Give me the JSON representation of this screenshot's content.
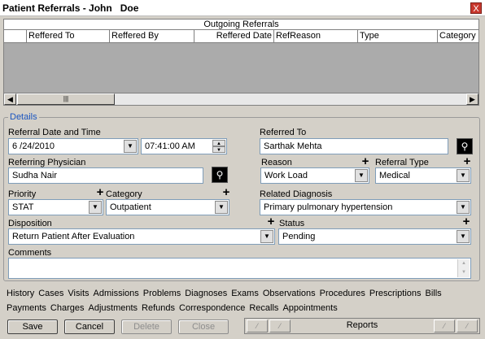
{
  "window": {
    "title": "Patient Referrals - John   Doe",
    "close_label": "X"
  },
  "grid": {
    "caption": "Outgoing Referrals",
    "columns": [
      "",
      "Reffered To",
      "Reffered By",
      "Reffered Date",
      "RefReason",
      "Type",
      "Category"
    ]
  },
  "details": {
    "legend": "Details",
    "referral_date_label": "Referral Date and Time",
    "referral_date": "6 /24/2010",
    "referral_time": "07:41:00 AM",
    "referred_to_label": "Referred To",
    "referred_to": "Sarthak Mehta",
    "referring_physician_label": "Referring Physician",
    "referring_physician": "Sudha Nair",
    "reason_label": "Reason",
    "reason": "Work Load",
    "referral_type_label": "Referral Type",
    "referral_type": "Medical",
    "priority_label": "Priority",
    "priority": "STAT",
    "category_label": "Category",
    "category": "Outpatient",
    "related_diagnosis_label": "Related Diagnosis",
    "related_diagnosis": "Primary pulmonary hypertension",
    "disposition_label": "Disposition",
    "disposition": "Return Patient After Evaluation",
    "status_label": "Status",
    "status": "Pending",
    "comments_label": "Comments",
    "comments": ""
  },
  "links_row1": [
    "History",
    "Cases",
    "Visits",
    "Admissions",
    "Problems",
    "Diagnoses",
    "Exams",
    "Observations",
    "Procedures",
    "Prescriptions",
    "Bills"
  ],
  "links_row2": [
    "Payments",
    "Charges",
    "Adjustments",
    "Refunds",
    "Correspondence",
    "Recalls",
    "Appointments"
  ],
  "buttons": {
    "save": "Save",
    "cancel": "Cancel",
    "delete": "Delete",
    "close": "Close"
  },
  "reports_label": "Reports",
  "plus_glyph": "+",
  "icons": {
    "magnifier": "magnifier-icon",
    "dropdown": "chevron-down-icon"
  }
}
